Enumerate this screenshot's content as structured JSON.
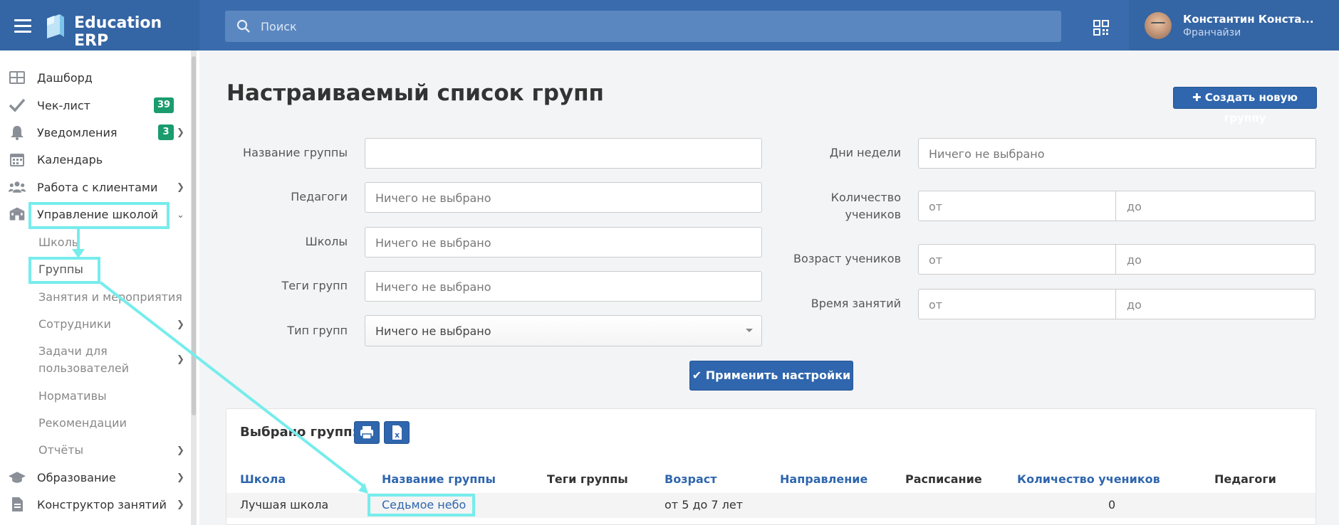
{
  "header": {
    "brand": "Education ERP",
    "search_placeholder": "Поиск",
    "user_name": "Константин Конста...",
    "user_role": "Франчайзи"
  },
  "sidebar": {
    "items": [
      {
        "label": "Дашборд",
        "icon": "dashboard-icon"
      },
      {
        "label": "Чек-лист",
        "icon": "check-icon",
        "badge": "39"
      },
      {
        "label": "Уведомления",
        "icon": "bell-icon",
        "badge": "3"
      },
      {
        "label": "Календарь",
        "icon": "calendar-icon"
      },
      {
        "label": "Работа с клиентами",
        "icon": "users-icon"
      },
      {
        "label": "Управление школой",
        "icon": "school-icon"
      }
    ],
    "sub_items": [
      {
        "label": "Школы"
      },
      {
        "label": "Группы"
      },
      {
        "label": "Занятия и мероприятия"
      },
      {
        "label": "Сотрудники"
      },
      {
        "label": "Задачи для"
      },
      {
        "label": "пользователей"
      },
      {
        "label": "Нормативы"
      },
      {
        "label": "Рекомендации"
      },
      {
        "label": "Отчёты"
      }
    ],
    "bottom_items": [
      {
        "label": "Образование",
        "icon": "graduation-cap-icon"
      },
      {
        "label": "Конструктор занятий",
        "icon": "document-icon"
      }
    ]
  },
  "main": {
    "title": "Настраиваемый список групп",
    "create_button": "Создать новую группу",
    "filters_left": [
      {
        "label": "Название группы",
        "placeholder": ""
      },
      {
        "label": "Педагоги",
        "placeholder": "Ничего не выбрано"
      },
      {
        "label": "Школы",
        "placeholder": "Ничего не выбрано"
      },
      {
        "label": "Теги групп",
        "placeholder": "Ничего не выбрано"
      },
      {
        "label": "Тип групп",
        "placeholder": "Ничего не выбрано"
      }
    ],
    "filters_right": {
      "days_label": "Дни недели",
      "days_placeholder": "Ничего не выбрано",
      "count_label_1": "Количество",
      "count_label_2": "учеников",
      "age_label": "Возраст учеников",
      "time_label": "Время занятий",
      "from": "от",
      "to": "до"
    },
    "apply_button": "Применить настройки",
    "selected_label": "Выбрано групп: 1",
    "table": {
      "headers": [
        "Школа",
        "Название группы",
        "Теги группы",
        "Возраст",
        "Направление",
        "Расписание",
        "Количество учеников",
        "Педагоги"
      ],
      "rows": [
        {
          "school": "Лучшая школа",
          "name": "Седьмое небо",
          "tags": "",
          "age": "от 5 до 7 лет",
          "direction": "",
          "schedule": "",
          "count": "0",
          "teachers": ""
        }
      ]
    }
  },
  "colors": {
    "header": "#3a6cad",
    "accent": "#2f66ad",
    "badge": "#1a9c6e",
    "annotation": "#77ecec"
  }
}
